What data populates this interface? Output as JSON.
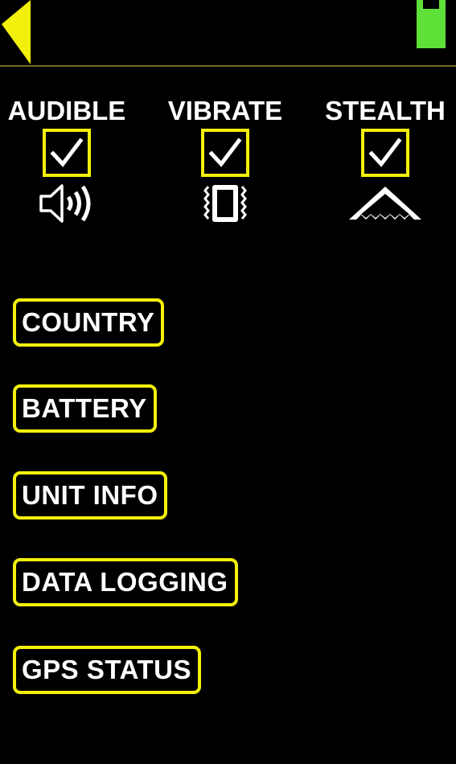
{
  "header": {
    "back_icon": "back-arrow-icon",
    "battery_icon": "battery-level-icon",
    "battery_level": 0.82,
    "battery_color": "#5fe038",
    "accent_color": "#f3f00b"
  },
  "alert_modes": [
    {
      "label": "AUDIBLE",
      "checked": true,
      "icon": "speaker-icon"
    },
    {
      "label": "VIBRATE",
      "checked": true,
      "icon": "vibrate-icon"
    },
    {
      "label": "STEALTH",
      "checked": true,
      "icon": "stealth-icon"
    }
  ],
  "menu": {
    "country": "COUNTRY",
    "battery": "BATTERY",
    "unit_info": "UNIT INFO",
    "data_logging": "DATA LOGGING",
    "gps_status": "GPS STATUS"
  }
}
